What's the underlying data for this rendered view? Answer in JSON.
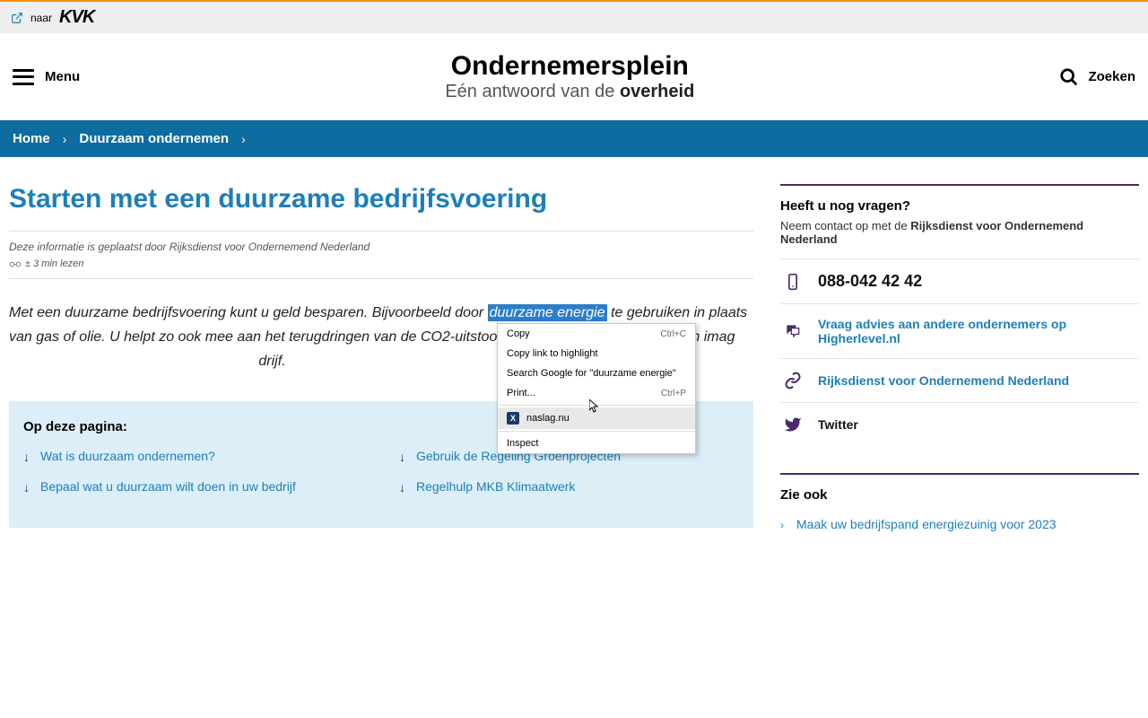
{
  "topbar": {
    "naar": "naar",
    "kvk": "KVK"
  },
  "header": {
    "menu": "Menu",
    "brand_title": "Ondernemersplein",
    "brand_sub_pre": "Eén antwoord van de ",
    "brand_sub_strong": "overheid",
    "search": "Zoeken"
  },
  "breadcrumb": {
    "home": "Home",
    "section": "Duurzaam ondernemen"
  },
  "page": {
    "title": "Starten met een duurzame bedrijfsvoering",
    "meta": "Deze informatie is geplaatst door Rijksdienst voor Ondernemend Nederland",
    "read_time": "± 3 min lezen",
    "intro_pre": "Met een duurzame bedrijfsvoering kunt u geld besparen. Bijvoorbeeld door ",
    "intro_highlight": "duurzame energie",
    "intro_mid": " te gebruiken in plaats van gas of olie. U helpt zo ook mee aan het terugdringen van de CO2-uitstoot. Bovendien kan een duurzaam imag",
    "intro_end": "drijf."
  },
  "toc": {
    "title": "Op deze pagina:",
    "col1": [
      "Wat is duurzaam ondernemen?",
      "Bepaal wat u duurzaam wilt doen in uw bedrijf"
    ],
    "col2": [
      "Gebruik de Regeling Groenprojecten",
      "Regelhulp MKB Klimaatwerk"
    ]
  },
  "sidebar": {
    "questions_title": "Heeft u nog vragen?",
    "contact_pre": "Neem contact op met de ",
    "contact_strong": "Rijksdienst voor Ondernemend Nederland",
    "phone": "088-042 42 42",
    "advice": "Vraag advies aan andere ondernemers op Higherlevel.nl",
    "rvo": "Rijksdienst voor Ondernemend Nederland",
    "twitter": "Twitter",
    "seealso_title": "Zie ook",
    "seealso_item": "Maak uw bedrijfspand energiezuinig voor 2023"
  },
  "context_menu": {
    "copy": "Copy",
    "copy_sc": "Ctrl+C",
    "copy_link": "Copy link to highlight",
    "search_google": "Search Google for \"duurzame energie\"",
    "print": "Print...",
    "print_sc": "Ctrl+P",
    "naslag": "naslag.nu",
    "inspect": "Inspect"
  }
}
